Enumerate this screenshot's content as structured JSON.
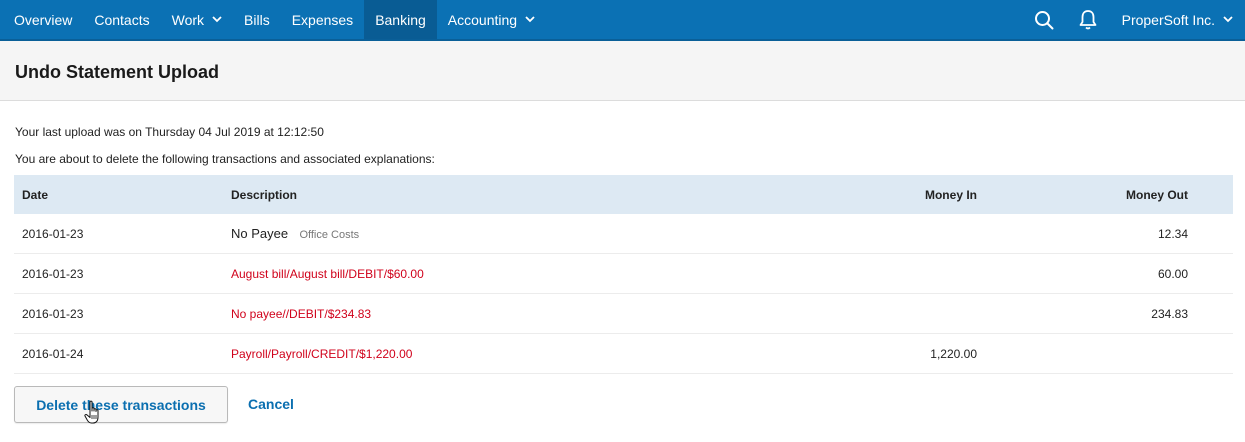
{
  "nav": {
    "items": [
      {
        "label": "Overview",
        "dropdown": false,
        "active": false
      },
      {
        "label": "Contacts",
        "dropdown": false,
        "active": false
      },
      {
        "label": "Work",
        "dropdown": true,
        "active": false
      },
      {
        "label": "Bills",
        "dropdown": false,
        "active": false
      },
      {
        "label": "Expenses",
        "dropdown": false,
        "active": false
      },
      {
        "label": "Banking",
        "dropdown": false,
        "active": true
      },
      {
        "label": "Accounting",
        "dropdown": true,
        "active": false
      }
    ],
    "search_icon": "search-icon",
    "notifications_icon": "bell-icon",
    "account_label": "ProperSoft Inc."
  },
  "page": {
    "title": "Undo Statement Upload",
    "last_upload": "Your last upload was on Thursday 04 Jul 2019 at 12:12:50",
    "warning": "You are about to delete the following transactions and associated explanations:"
  },
  "table": {
    "headers": {
      "date": "Date",
      "description": "Description",
      "money_in": "Money In",
      "money_out": "Money Out"
    },
    "rows": [
      {
        "date": "2016-01-23",
        "description": "No Payee",
        "category": "Office Costs",
        "money_in": "",
        "money_out": "12.34",
        "linked": false
      },
      {
        "date": "2016-01-23",
        "description": "August bill/August bill/DEBIT/$60.00",
        "category": "",
        "money_in": "",
        "money_out": "60.00",
        "linked": true
      },
      {
        "date": "2016-01-23",
        "description": "No payee//DEBIT/$234.83",
        "category": "",
        "money_in": "",
        "money_out": "234.83",
        "linked": true
      },
      {
        "date": "2016-01-24",
        "description": "Payroll/Payroll/CREDIT/$1,220.00",
        "category": "",
        "money_in": "1,220.00",
        "money_out": "",
        "linked": true
      }
    ]
  },
  "actions": {
    "delete_label": "Delete these transactions",
    "cancel_label": "Cancel"
  },
  "colors": {
    "nav_bg": "#0b71b4",
    "nav_active": "#095c94",
    "link_blue": "#0b6fb0",
    "link_red": "#d0021b",
    "header_row_bg": "#dde9f3"
  }
}
